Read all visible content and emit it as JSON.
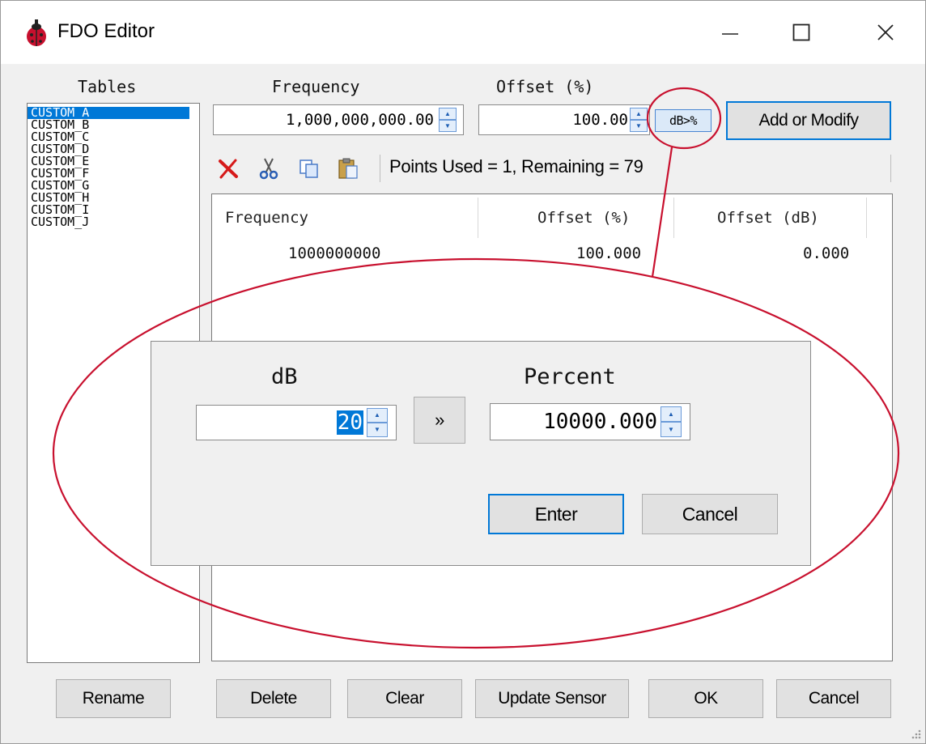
{
  "window": {
    "title": "FDO Editor"
  },
  "titlebar": {
    "minimize_icon": "minimize-icon",
    "maximize_icon": "maximize-icon",
    "close_icon": "close-icon"
  },
  "tables": {
    "label": "Tables",
    "items": [
      "CUSTOM_A",
      "CUSTOM_B",
      "CUSTOM_C",
      "CUSTOM_D",
      "CUSTOM_E",
      "CUSTOM_F",
      "CUSTOM_G",
      "CUSTOM_H",
      "CUSTOM_I",
      "CUSTOM_J"
    ],
    "selected": "CUSTOM_A"
  },
  "entry": {
    "frequency_label": "Frequency",
    "frequency_value": "1,000,000,000.00",
    "offset_label": "Offset (%)",
    "offset_value": "100.00",
    "db_to_pct_label": "dB>%",
    "add_modify_label": "Add or Modify"
  },
  "toolbar": {
    "icons": [
      "delete-icon",
      "cut-icon",
      "copy-icon",
      "paste-icon"
    ],
    "points_text": "Points  Used = 1,  Remaining = 79"
  },
  "grid": {
    "columns": [
      "Frequency",
      "Offset (%)",
      "Offset (dB)"
    ],
    "rows": [
      [
        "1000000000",
        "100.000",
        "0.000"
      ]
    ]
  },
  "dialog": {
    "db_label": "dB",
    "db_value": "20",
    "convert_label": "»",
    "percent_label": "Percent",
    "percent_value": "10000.000",
    "enter_label": "Enter",
    "cancel_label": "Cancel"
  },
  "bottom_buttons": {
    "rename": "Rename",
    "delete": "Delete",
    "clear": "Clear",
    "update_sensor": "Update Sensor",
    "ok": "OK",
    "cancel": "Cancel"
  },
  "colors": {
    "selection": "#0078d7",
    "annotation": "#c8102e"
  }
}
